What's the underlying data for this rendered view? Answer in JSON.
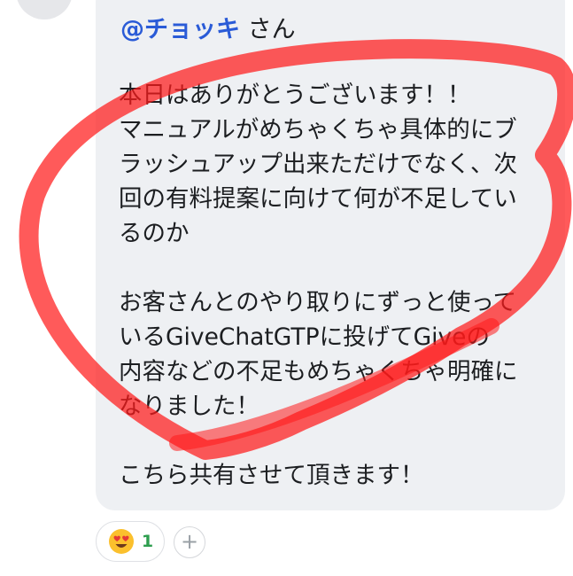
{
  "message": {
    "mention": {
      "handle": "@チョッキ",
      "honorific": "さん"
    },
    "lines": [
      "本日はありがとうございます！！",
      "マニュアルがめちゃくちゃ具体的にブ",
      "ラッシュアップ出来ただけでなく、次",
      "回の有料提案に向けて何が不足してい",
      "るのか",
      "お客さんとのやり取りにずっと使って",
      "いるGiveChatGTPに投げてGiveの",
      "内容などの不足もめちゃくちゃ明確に",
      "なりました！",
      "こちら共有させて頂きます！"
    ]
  },
  "reactions": [
    {
      "emoji": "heart-eyes-emoji",
      "count": "1"
    }
  ],
  "add_reaction": {
    "label": "+"
  },
  "colors": {
    "bubble": "#eef0f3",
    "mention": "#2a5bd7",
    "text": "#1c1e21",
    "reaction_count": "#2e9e4f",
    "marker": "#ff1a1a"
  }
}
